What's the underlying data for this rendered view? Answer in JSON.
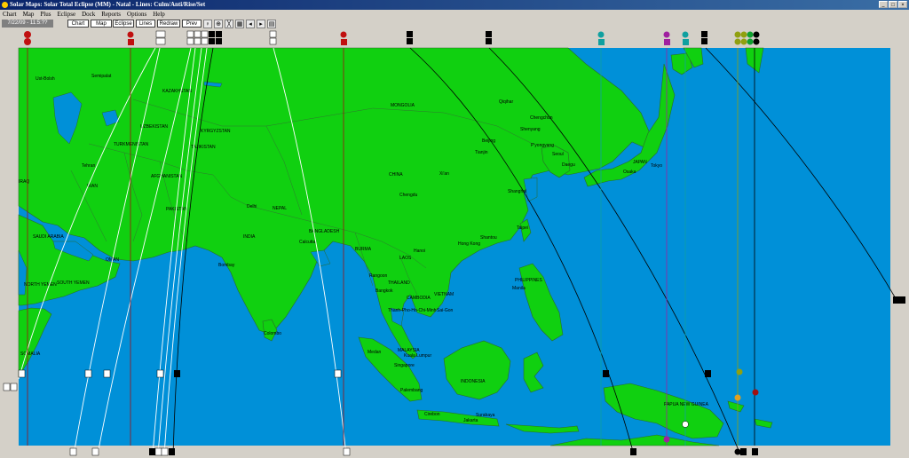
{
  "window": {
    "title": "Solar Maps: Solar Total Eclipse (MM) - Natal - Lines: Culm/Anti/Rise/Set",
    "minimize": "_",
    "maximize": "□",
    "close": "×"
  },
  "menu": [
    "Chart",
    "Map",
    "Plus",
    "Eclipse",
    "Dock",
    "Reports",
    "Options",
    "Help"
  ],
  "toolbar": {
    "date": "7/22/09 - 11:5:??",
    "buttons": [
      "Chart",
      "Map",
      "Eclipse",
      "Lines",
      "Redraw",
      "Prev"
    ],
    "icons": [
      "planet-glyph-icon",
      "zoom-icon",
      "line-tool-icon",
      "grid-icon",
      "arrow-left-icon",
      "arrow-right-icon",
      "print-icon"
    ]
  },
  "colors": {
    "ocean": "#0090d8",
    "land": "#10d010",
    "border": "#3c7a3c",
    "line_white": "#ffffff",
    "line_black": "#000000",
    "line_red": "#a01010",
    "line_teal": "#10a0a0",
    "line_purple": "#a020a0",
    "line_olive": "#90a010"
  },
  "map_labels": [
    "Ust-Bolsh",
    "Semipalat",
    "KAZAKHSTAN",
    "MONGOLIA",
    "Qiqihar",
    "Chengchun",
    "Shenyang",
    "UZBEKISTAN",
    "KYRGYZSTAN",
    "TURKMENISTAN",
    "TAJIKISTAN",
    "Beijing",
    "Tianjin",
    "P'yongyang",
    "Seoul",
    "Daegu",
    "JAPAN",
    "Osaka",
    "Tokyo",
    "Tehran",
    "IRAN",
    "AFGHANISTAN",
    "CHINA",
    "Xi'an",
    "Chengdu",
    "Shanghai",
    "IRAQ",
    "PAKISTAN",
    "Delhi",
    "NEPAL",
    "BANGLADESH",
    "INDIA",
    "Calcutta",
    "BURMA",
    "Hanoi",
    "Taipei",
    "Shantou",
    "Hong Kong",
    "LAOS",
    "SAUDI ARABIA",
    "OMAN",
    "Bombay",
    "Rangoon",
    "THAILAND",
    "Bangkok",
    "PHILIPPINES",
    "Manila",
    "NORTH YEMEN",
    "SOUTH YEMEN",
    "CAMBODIA",
    "VIETNAM",
    "Thanh-Pho-Ho-Chi-Minh",
    "Sai-Gon",
    "Colombo",
    "SOMALIA",
    "Medan",
    "MALAYSIA",
    "Kuala Lumpur",
    "Singapore",
    "INDONESIA",
    "Palembang",
    "PAPUA NEW GUINEA",
    "Cirebon",
    "Surabaya",
    "Jakarta"
  ]
}
